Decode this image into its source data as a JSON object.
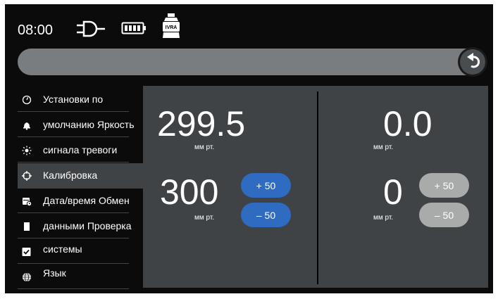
{
  "status": {
    "time": "08:00",
    "icons": [
      "power-plug-icon",
      "battery-full-icon",
      "ivra-device-icon"
    ],
    "ivra_label": "IVRA"
  },
  "menu": {
    "items": [
      {
        "label": "Установки по",
        "icon": "gauge-icon",
        "active": false
      },
      {
        "label": "умолчанию Яркость",
        "icon": "bell-icon",
        "active": false
      },
      {
        "label": "сигнала тревоги",
        "icon": "brightness-icon",
        "active": false
      },
      {
        "label": "Калибровка",
        "icon": "crosshair-icon",
        "active": true
      },
      {
        "label": "Дата/время Обмен",
        "icon": "calendar-clock-icon",
        "active": false
      },
      {
        "label": "данными Проверка",
        "icon": "sd-card-icon",
        "active": false
      },
      {
        "label": "системы",
        "icon": "checkbox-icon",
        "active": false
      },
      {
        "label": "Язык",
        "icon": "globe-icon",
        "active": false
      }
    ]
  },
  "left": {
    "measured": "299.5",
    "measured_unit": "мм рт.",
    "setpoint": "300",
    "setpoint_unit": "мм рт.",
    "plus_label": "+ 50",
    "minus_label": "– 50"
  },
  "right": {
    "measured": "0.0",
    "measured_unit": "мм рт.",
    "setpoint": "0",
    "setpoint_unit": "мм рт.",
    "plus_label": "+ 50",
    "minus_label": "– 50"
  },
  "colors": {
    "background": "#0b0b0b",
    "panel": "#3f4346",
    "titlebar": "#7a7d80",
    "button_active": "#2f6bc0",
    "button_disabled": "#a9aaaa"
  }
}
